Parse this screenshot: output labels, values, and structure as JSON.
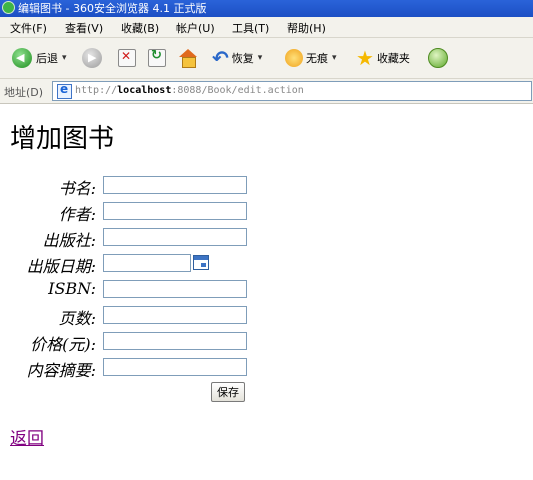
{
  "window": {
    "title": "编辑图书 - 360安全浏览器 4.1 正式版"
  },
  "menubar": {
    "items": [
      "文件(F)",
      "查看(V)",
      "收藏(B)",
      "帐户(U)",
      "工具(T)",
      "帮助(H)"
    ]
  },
  "toolbar": {
    "back_label": "后退",
    "restore_label": "恢复",
    "notrace_label": "无痕",
    "favorites_label": "收藏夹"
  },
  "addressbar": {
    "label": "地址(D)",
    "url_scheme": "http://",
    "url_host": "localhost",
    "url_rest": ":8088/Book/edit.action"
  },
  "page": {
    "title": "增加图书",
    "fields": [
      {
        "label": "书名:",
        "value": ""
      },
      {
        "label": "作者:",
        "value": ""
      },
      {
        "label": "出版社:",
        "value": ""
      },
      {
        "label": "出版日期:",
        "value": ""
      },
      {
        "label": "ISBN:",
        "value": ""
      },
      {
        "label": "页数:",
        "value": ""
      },
      {
        "label": "价格(元):",
        "value": ""
      },
      {
        "label": "内容摘要:",
        "value": ""
      }
    ],
    "save_label": "保存",
    "back_link": "返回"
  }
}
